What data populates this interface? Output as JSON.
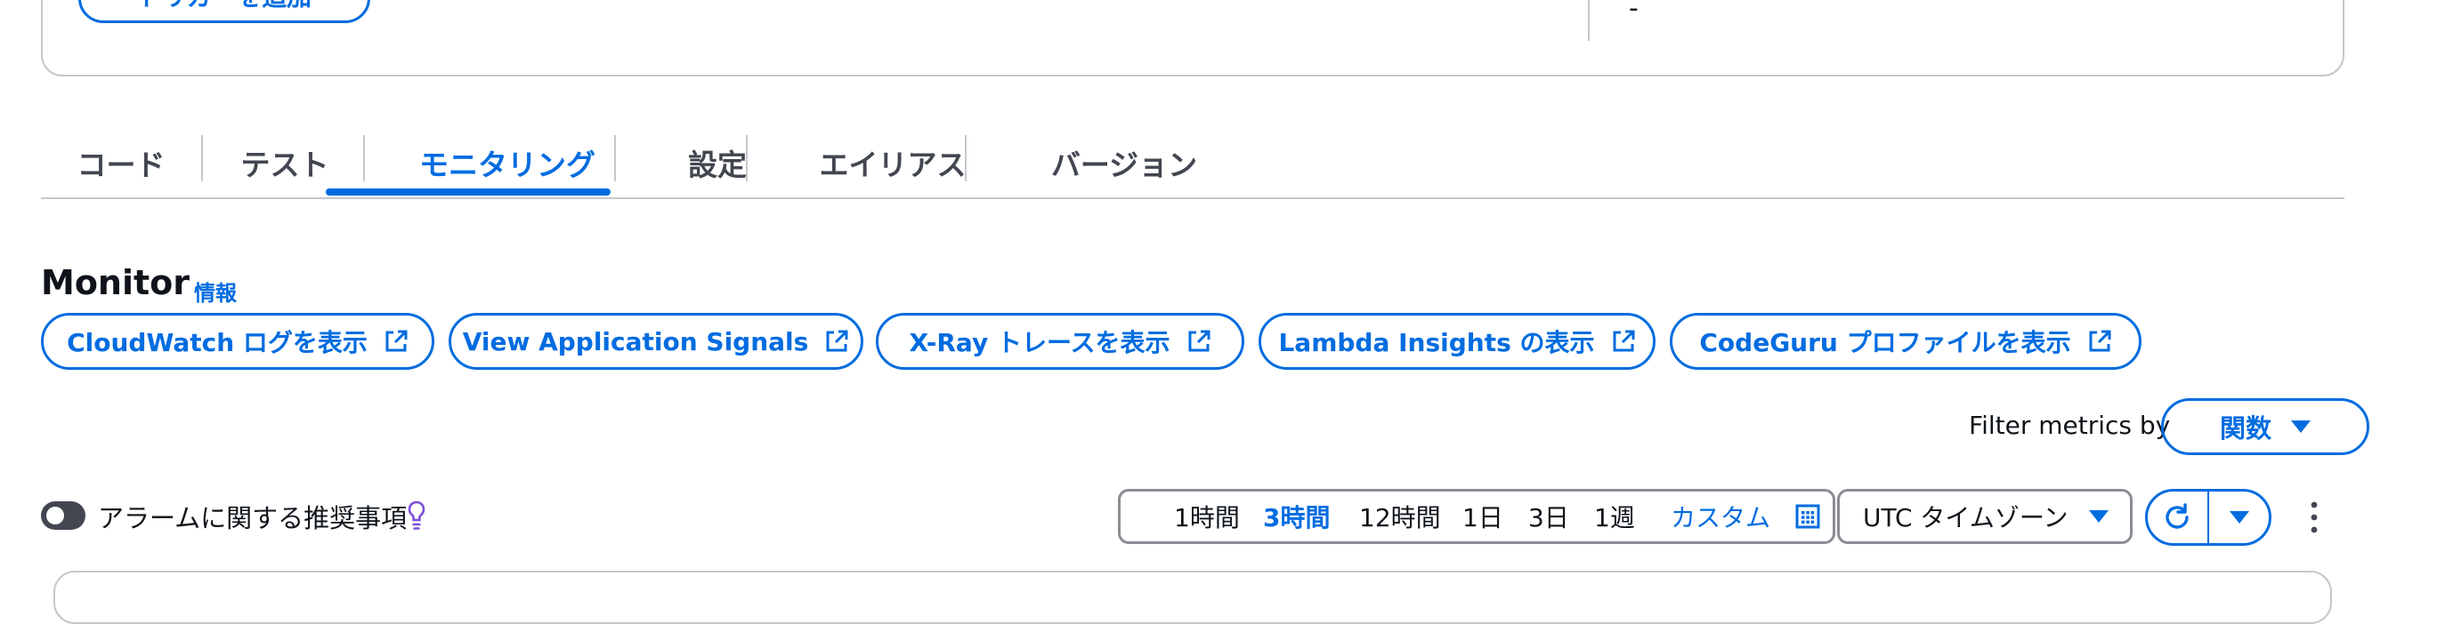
{
  "top_panel": {
    "trigger_button_label": "トリガーを追加",
    "value_dash": "-"
  },
  "tabs": [
    {
      "label": "コード"
    },
    {
      "label": "テスト"
    },
    {
      "label": "モニタリング",
      "active": true
    },
    {
      "label": "設定"
    },
    {
      "label": "エイリアス"
    },
    {
      "label": "バージョン"
    }
  ],
  "monitor": {
    "title": "Monitor",
    "info_link": "情報",
    "external_buttons": [
      {
        "label": "CloudWatch ログを表示",
        "icon": "external-link-icon"
      },
      {
        "label": "View Application Signals",
        "icon": "external-link-icon"
      },
      {
        "label": "X-Ray トレースを表示",
        "icon": "external-link-icon"
      },
      {
        "label": "Lambda Insights の表示",
        "icon": "external-link-icon"
      },
      {
        "label": "CodeGuru プロファイルを表示",
        "icon": "external-link-icon"
      }
    ],
    "filter": {
      "label": "Filter metrics by",
      "selected": "関数"
    },
    "alarm_toggle": {
      "label": "アラームに関する推奨事項",
      "enabled": false,
      "icon": "lightbulb-icon"
    },
    "time_ranges": {
      "options": [
        "1時間",
        "3時間",
        "12時間",
        "1日",
        "3日",
        "1週"
      ],
      "selected": "3時間",
      "custom_label": "カスタム"
    },
    "timezone": {
      "selected": "UTC タイムゾーン"
    }
  },
  "colors": {
    "accent": "#006ce0",
    "border": "#c6c6cd",
    "text": "#0f141a",
    "muted_text": "#424650",
    "bulb": "#7d4fd8"
  }
}
